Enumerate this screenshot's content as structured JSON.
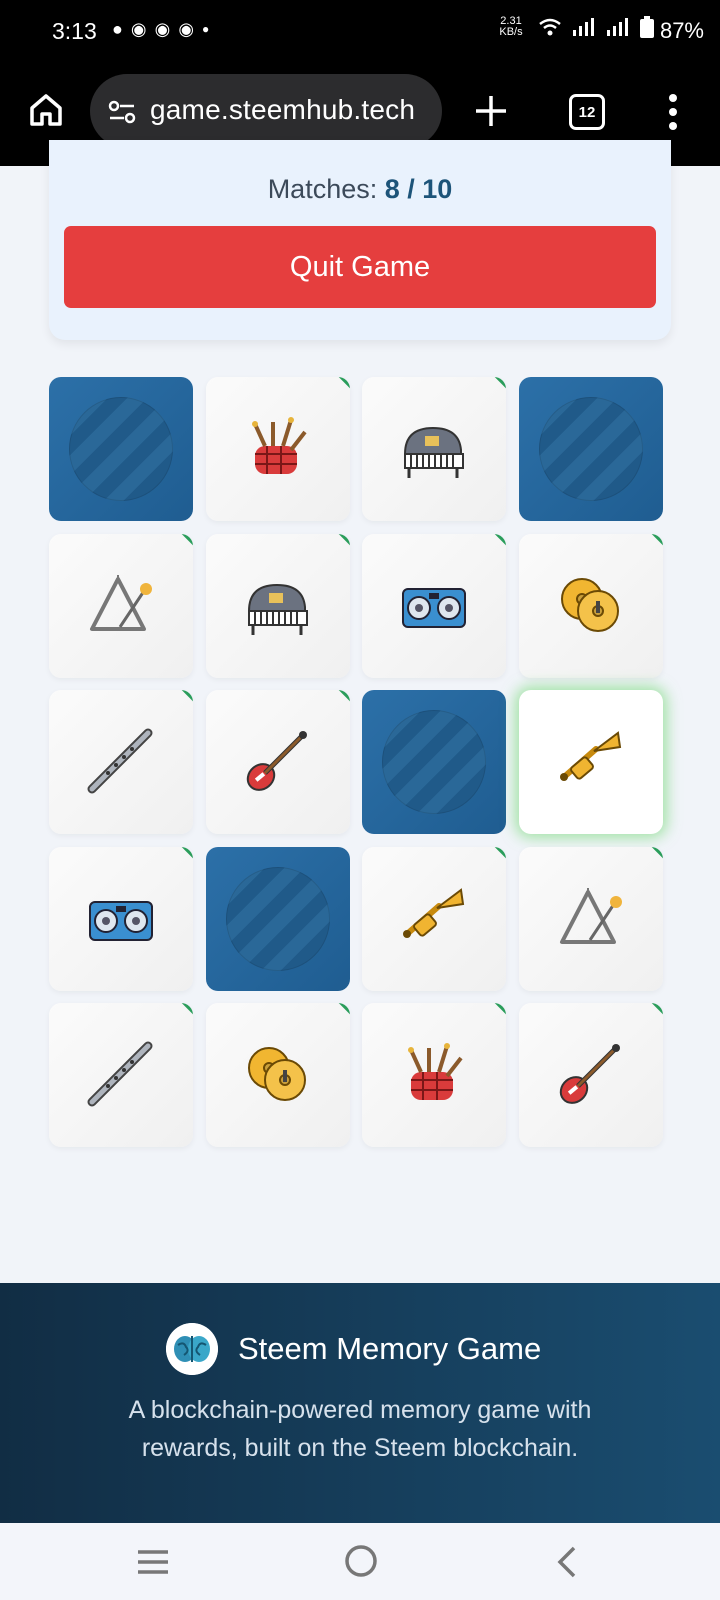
{
  "status_bar": {
    "time": "3:13",
    "net_speed": "2.31\nKB/s",
    "net_speed_value": "2.31",
    "net_speed_unit": "KB/s",
    "battery": "87%"
  },
  "browser": {
    "url": "game.steemhub.tech",
    "tab_count": "12"
  },
  "game": {
    "matches_label": "Matches:",
    "matches_value": "8 / 10",
    "quit_label": "Quit Game",
    "cards": [
      {
        "state": "hidden",
        "icon": ""
      },
      {
        "state": "matched",
        "icon": "bagpipes-icon"
      },
      {
        "state": "matched",
        "icon": "piano-icon"
      },
      {
        "state": "hidden",
        "icon": ""
      },
      {
        "state": "matched",
        "icon": "triangle-icon"
      },
      {
        "state": "matched",
        "icon": "piano-icon"
      },
      {
        "state": "matched",
        "icon": "boombox-icon"
      },
      {
        "state": "matched",
        "icon": "cymbals-icon"
      },
      {
        "state": "matched",
        "icon": "flute-icon"
      },
      {
        "state": "matched",
        "icon": "guitar-icon"
      },
      {
        "state": "hidden",
        "icon": ""
      },
      {
        "state": "revealed",
        "icon": "trumpet-icon"
      },
      {
        "state": "matched",
        "icon": "boombox-icon"
      },
      {
        "state": "hidden",
        "icon": ""
      },
      {
        "state": "matched",
        "icon": "trumpet-icon"
      },
      {
        "state": "matched",
        "icon": "triangle-icon"
      },
      {
        "state": "matched",
        "icon": "flute-icon"
      },
      {
        "state": "matched",
        "icon": "cymbals-icon"
      },
      {
        "state": "matched",
        "icon": "bagpipes-icon"
      },
      {
        "state": "matched",
        "icon": "guitar-icon"
      }
    ]
  },
  "footer": {
    "title": "Steem Memory Game",
    "description": "A blockchain-powered memory game with rewards, built on the Steem blockchain."
  },
  "colors": {
    "accent": "#1d5479",
    "quit": "#e53e3e",
    "card_back": "#2c70a8",
    "match_corner": "#2a9d5b",
    "selected_glow": "#62d662"
  }
}
